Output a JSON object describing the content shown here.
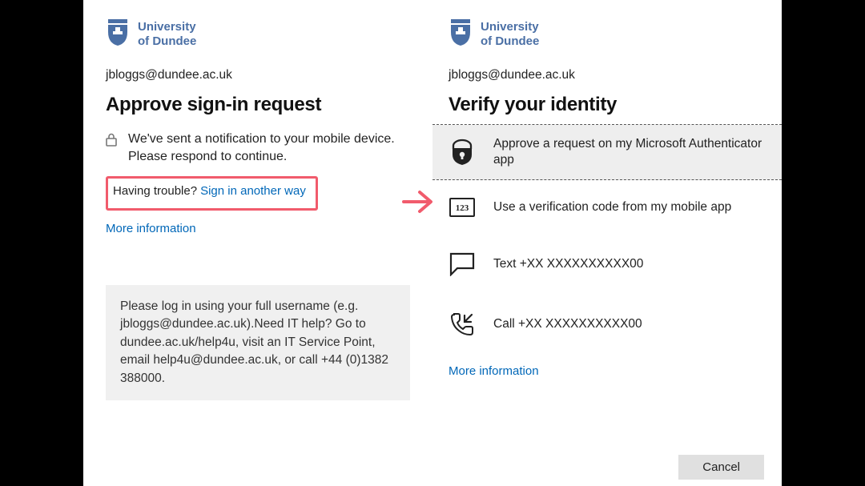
{
  "logo": {
    "line1": "University",
    "line2": "of Dundee"
  },
  "left": {
    "username": "jbloggs@dundee.ac.uk",
    "heading": "Approve sign-in request",
    "notice": "We've sent a notification to your mobile device. Please respond to continue.",
    "trouble_label": "Having trouble?",
    "trouble_link": "Sign in another way",
    "more_info": "More information",
    "help_text": "Please log in using your full username (e.g. jbloggs@dundee.ac.uk).Need IT help? Go to dundee.ac.uk/help4u, visit an IT Service Point, email help4u@dundee.ac.uk, or call +44 (0)1382 388000."
  },
  "right": {
    "username": "jbloggs@dundee.ac.uk",
    "heading": "Verify your identity",
    "methods": [
      {
        "label": "Approve a request on my Microsoft Authenticator app"
      },
      {
        "label": "Use a verification code from my mobile app"
      },
      {
        "label": "Text +XX XXXXXXXXXX00"
      },
      {
        "label": "Call +XX XXXXXXXXXX00"
      }
    ],
    "more_info": "More information",
    "cancel": "Cancel"
  }
}
